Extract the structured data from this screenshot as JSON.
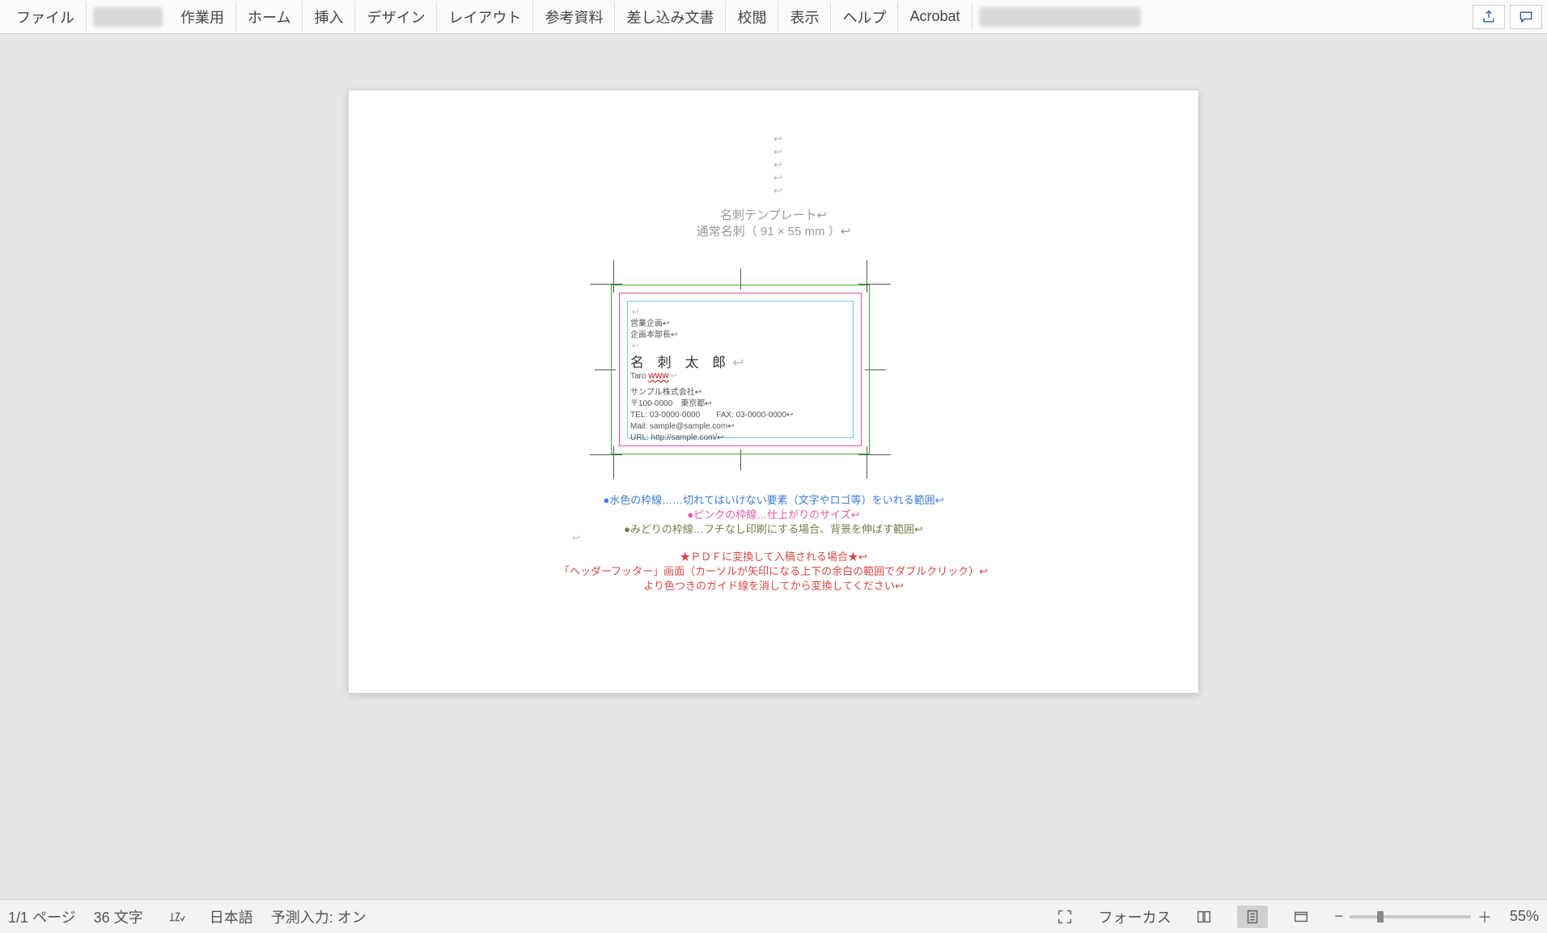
{
  "ribbon": {
    "file": "ファイル",
    "tabs": [
      "作業用",
      "ホーム",
      "挿入",
      "デザイン",
      "レイアウト",
      "参考資料",
      "差し込み文書",
      "校閲",
      "表示",
      "ヘルプ",
      "Acrobat"
    ]
  },
  "doc": {
    "header_title": "名刺テンプレート↩",
    "header_subtitle": "通常名刺（ 91 × 55 mm ）↩",
    "card": {
      "dept_line1": "営業企画↩",
      "dept_line2": "企画本部長↩",
      "name": "名 刺 太 郎",
      "romaji": "Taro ",
      "romaji_err": "WWW",
      "company": "サンプル株式会社↩",
      "addr": "〒100-0000　東京都↩",
      "tel_fax": "TEL: 03-0000-0000　　FAX: 03-0000-0000↩",
      "mail": "Mail: sample@sample.com↩",
      "url": "URL: http://sample.com/↩"
    },
    "legend": {
      "blue": "●水色の枠線……切れてはいけない要素（文字やロゴ等）をいれる範囲↩",
      "pink": "●ピンクの枠線…仕上がりのサイズ↩",
      "olive": "●みどりの枠線…フチなし印刷にする場合、背景を伸ばす範囲↩",
      "red1": "★ＰＤＦに変換して入稿される場合★↩",
      "red2": "「ヘッダーフッター」画面（カーソルが矢印になる上下の余白の範囲でダブルクリック）↩",
      "red3": "より色つきのガイド線を消してから変換してください↩"
    }
  },
  "status": {
    "page": "1/1 ページ",
    "words": "36 文字",
    "lang": "日本語",
    "predict": "予測入力: オン",
    "focus": "フォーカス",
    "zoom": "55%",
    "zoom_minus": "−",
    "zoom_plus": "＋"
  }
}
